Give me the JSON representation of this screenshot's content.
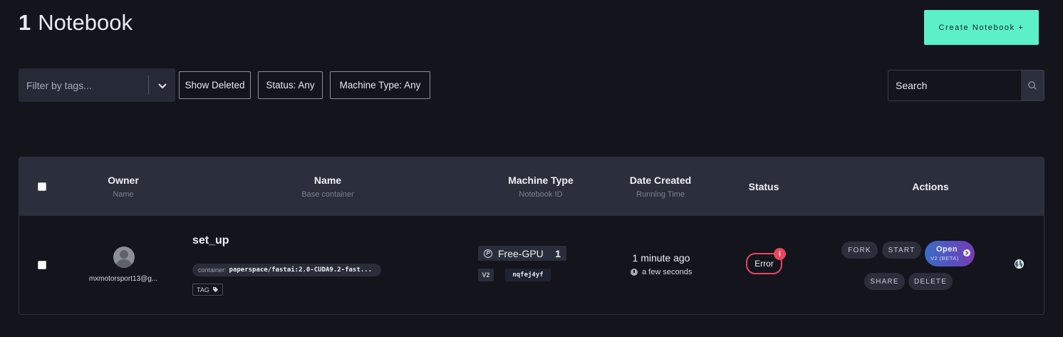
{
  "header": {
    "count": "1",
    "title_word": "Notebook",
    "create_button": "Create Notebook +"
  },
  "filters": {
    "tags_placeholder": "Filter by tags...",
    "show_deleted": "Show Deleted",
    "status": "Status: Any",
    "machine_type": "Machine Type: Any",
    "search_placeholder": "Search"
  },
  "table": {
    "columns": [
      {
        "title": "Owner",
        "subtitle": "Name"
      },
      {
        "title": "Name",
        "subtitle": "Base container"
      },
      {
        "title": "Machine Type",
        "subtitle": "Notebook ID"
      },
      {
        "title": "Date Created",
        "subtitle": "Running Time"
      },
      {
        "title": "Status",
        "subtitle": ""
      },
      {
        "title": "Actions",
        "subtitle": ""
      }
    ],
    "rows": [
      {
        "owner": "mxmotorsport13@g...",
        "name": "set_up",
        "container_label": "container:",
        "container": "paperspace/fastai:2.0-CUDA9.2-fast...",
        "tag": "TAG",
        "machine": "Free-GPU",
        "machine_count": "1",
        "version": "V2",
        "notebook_id": "nqfej4yf",
        "date_created": "1 minute ago",
        "running_time": "a few seconds",
        "status": "Error",
        "status_alert": "!",
        "actions": {
          "fork": "FORK",
          "start": "START",
          "open": "Open",
          "open_sub": "V2 (BETA)",
          "share": "SHARE",
          "delete": "DELETE"
        }
      }
    ]
  },
  "colors": {
    "background": "#13141c",
    "accent": "#5cf0c8",
    "error": "#e8455f"
  }
}
